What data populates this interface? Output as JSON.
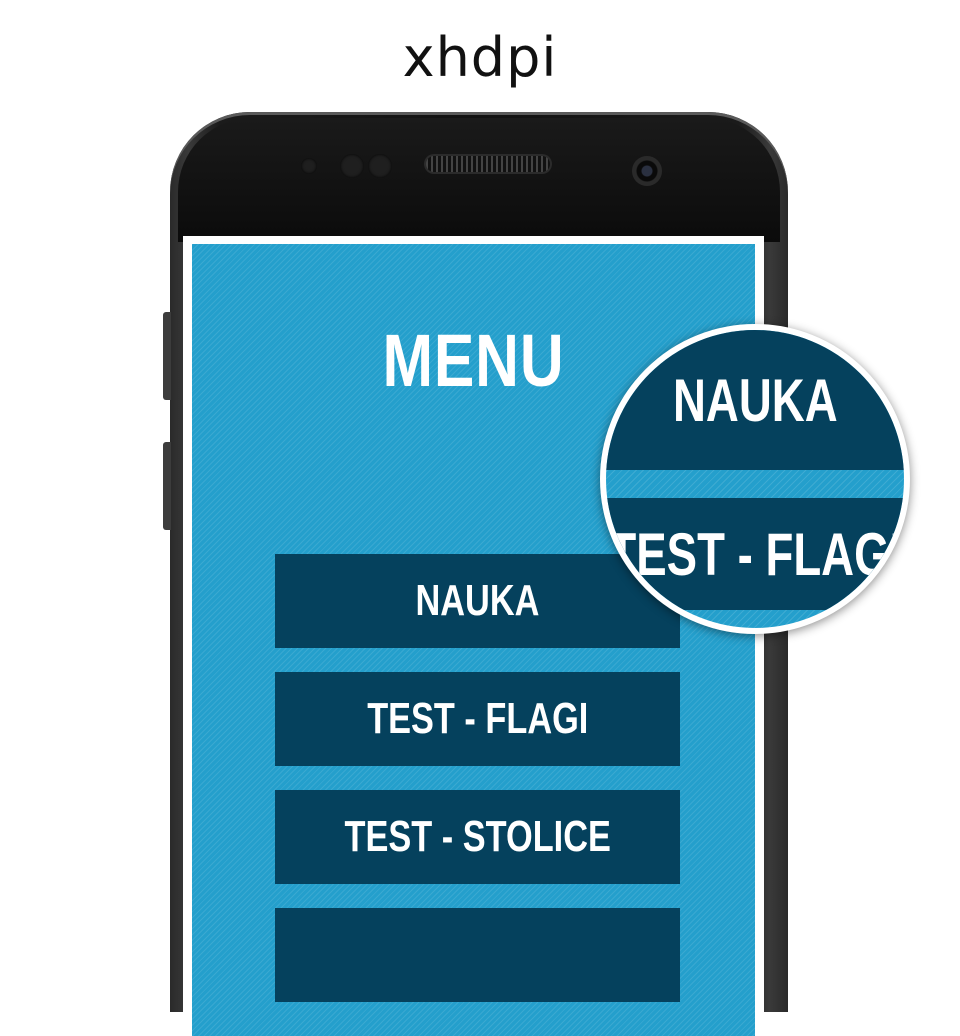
{
  "header": {
    "density_label": "xhdpi"
  },
  "app": {
    "title": "MENU",
    "menu_items": [
      {
        "label": "NAUKA"
      },
      {
        "label": "TEST - FLAGI"
      },
      {
        "label": "TEST - STOLICE"
      },
      {
        "label": ""
      }
    ]
  },
  "magnifier": {
    "items": [
      {
        "label": "NAUKA"
      },
      {
        "label": "TEST - FLAGI"
      }
    ]
  },
  "colors": {
    "screen_background": "#249fcc",
    "button_background": "#05415d",
    "text": "#ffffff"
  }
}
